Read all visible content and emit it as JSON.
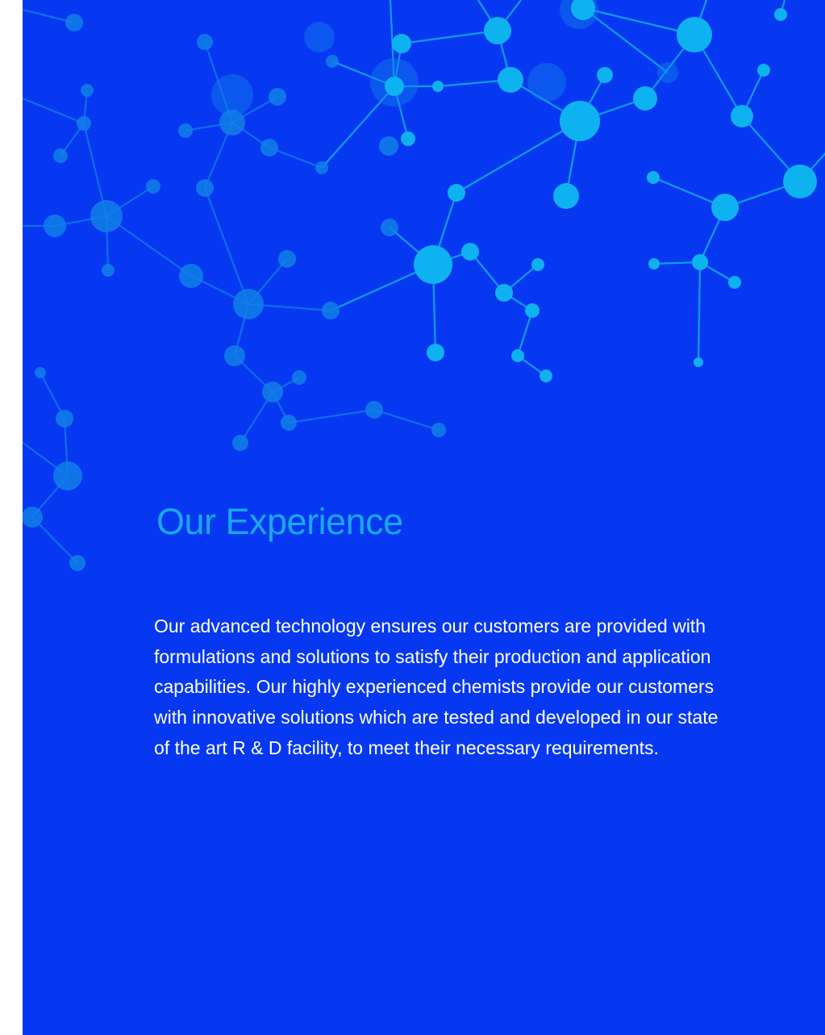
{
  "section": {
    "title": "Our Experience",
    "body": "Our advanced technology ensures our customers are provided with formulations and solutions to satisfy their production and application capabilities. Our highly experienced chemists provide our customers with innovative solutions which are tested and developed in our state of the art R & D facility, to meet their necessary requirements."
  },
  "colors": {
    "background": "#0638f2",
    "heading": "#1aa8f2",
    "body_text": "#ffffff",
    "molecule_light": "#0fb2f0",
    "molecule_mid": "#137fe8"
  },
  "decoration": {
    "background_graphic": "molecule-network-illustration"
  }
}
